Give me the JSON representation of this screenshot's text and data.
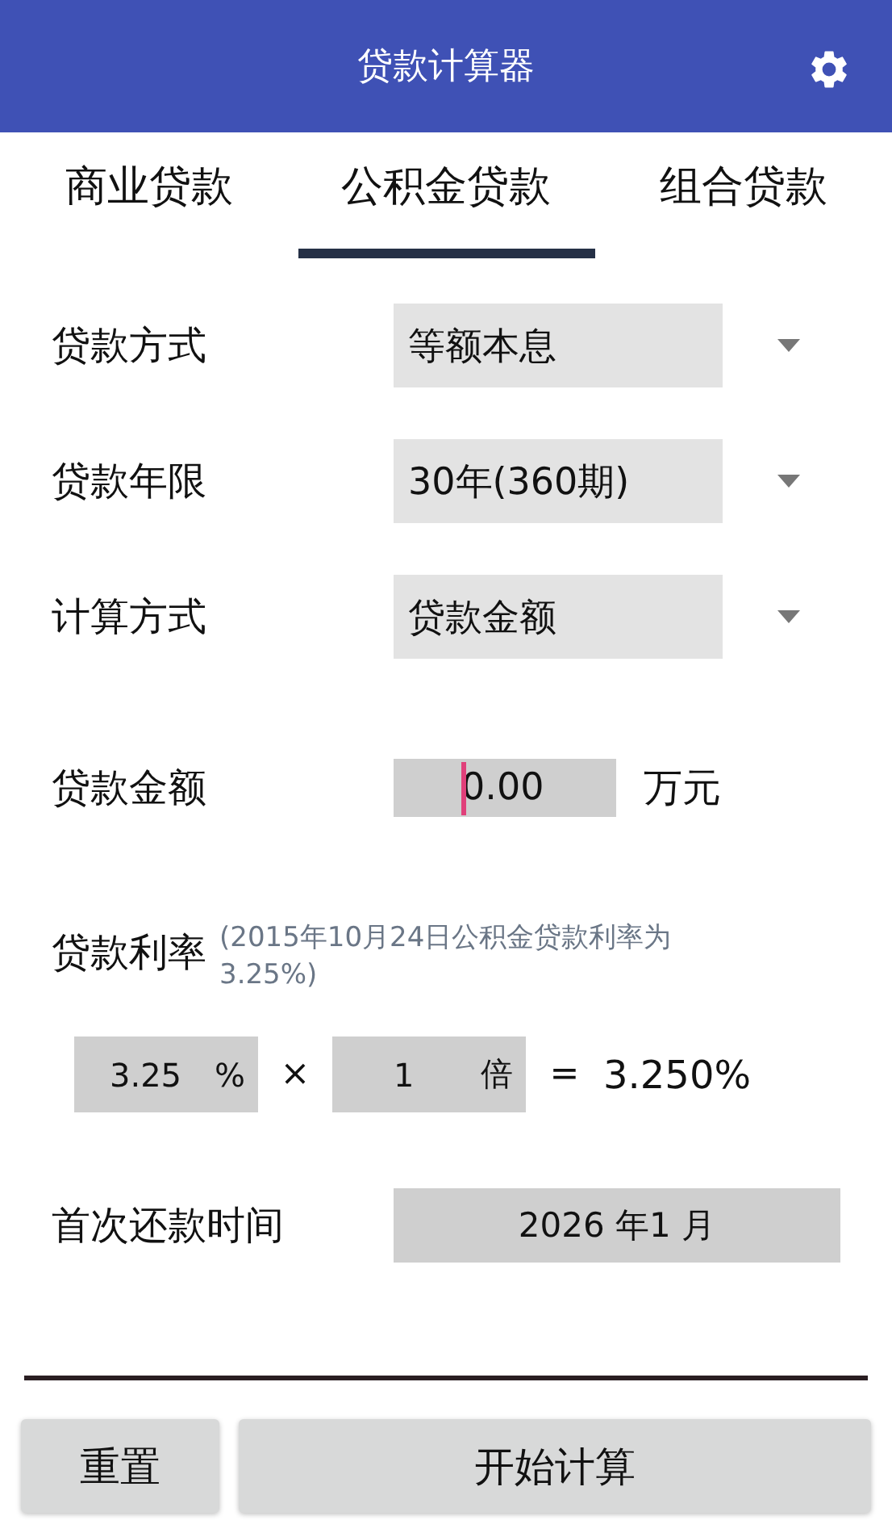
{
  "app_bar": {
    "title": "贷款计算器"
  },
  "tabs": [
    {
      "label": "商业贷款",
      "selected": false
    },
    {
      "label": "公积金贷款",
      "selected": true
    },
    {
      "label": "组合贷款",
      "selected": false
    }
  ],
  "dropdowns": [
    {
      "label": "贷款方式",
      "value": "等额本息"
    },
    {
      "label": "贷款年限",
      "value": "30年(360期)"
    },
    {
      "label": "计算方式",
      "value": "贷款金额"
    }
  ],
  "amount": {
    "label": "贷款金额",
    "value": "0.00",
    "unit": "万元"
  },
  "rate": {
    "label": "贷款利率",
    "note": "(2015年10月24日公积金贷款利率为3.25%)",
    "base": "3.25",
    "base_unit": "%",
    "times": "×",
    "multiplier": "1",
    "multiplier_unit": "倍",
    "equals": "=",
    "result": "3.250%"
  },
  "first_payment": {
    "label": "首次还款时间",
    "value": "2026 年1 月"
  },
  "buttons": [
    {
      "label": "重置",
      "kind": "reset"
    },
    {
      "label": "开始计算",
      "kind": "primary"
    }
  ]
}
